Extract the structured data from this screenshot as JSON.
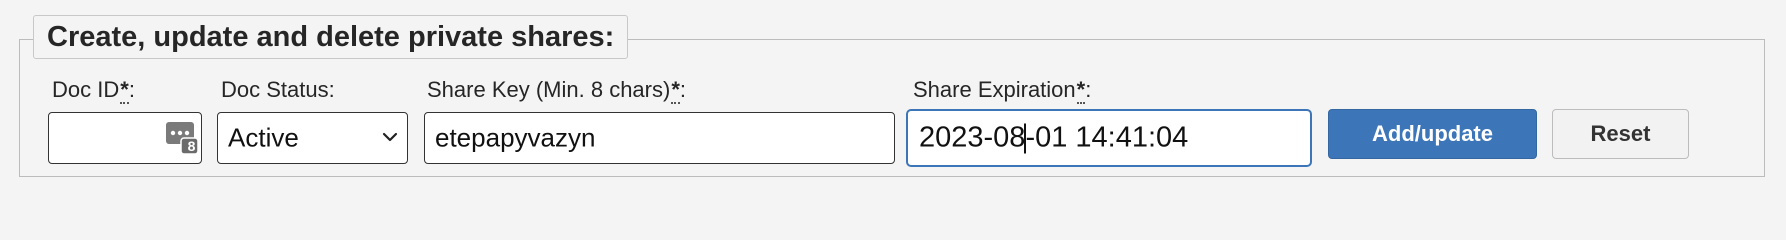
{
  "form": {
    "legend": "Create, update and delete private shares:",
    "required_marker": "*",
    "doc_id": {
      "label": "Doc ID",
      "label_suffix": ":",
      "value": "",
      "icon_badge": "8"
    },
    "doc_status": {
      "label": "Doc Status:",
      "selected": "Active"
    },
    "share_key": {
      "label": "Share Key (Min. 8 chars)",
      "label_suffix": ":",
      "value": "etepapyvazyn"
    },
    "share_expiration": {
      "label": "Share Expiration",
      "label_suffix": ":",
      "value_before_cursor": "2023-08",
      "value_after_cursor": "-01 14:41:04"
    },
    "buttons": {
      "add_update": "Add/update",
      "reset": "Reset"
    }
  },
  "colors": {
    "primary": "#3d76b8",
    "focus_border": "#3d76b8",
    "page_background": "#f4f4f4"
  },
  "icons": {
    "doc_id_icon": "password-manager-keypad-icon",
    "select_icon": "chevron-down-icon"
  }
}
